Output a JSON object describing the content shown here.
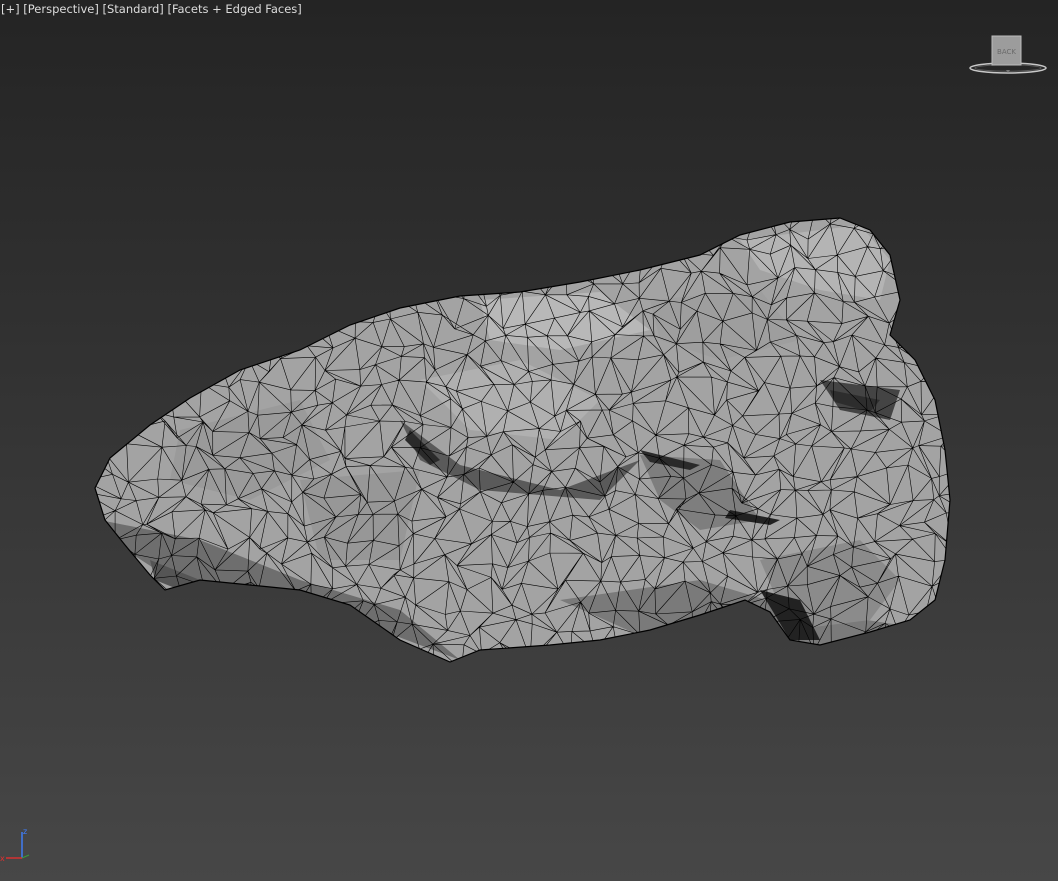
{
  "viewport": {
    "label_plus": "[+]",
    "label_view": "[Perspective]",
    "label_shading": "[Standard]",
    "label_display": "[Facets + Edged Faces]"
  },
  "viewcube": {
    "face_label": "BACK"
  },
  "axis_tripod": {
    "z_label": "z",
    "x_label": "x"
  },
  "colors": {
    "background_top": "#242424",
    "background_bottom": "#474747",
    "mesh_face": "#a3a3a3",
    "mesh_edge": "#000000",
    "axis_z": "#3f7fff",
    "axis_x": "#e03030"
  },
  "icons": {
    "viewcube": "viewcube-icon",
    "axis": "axis-tripod-icon"
  }
}
